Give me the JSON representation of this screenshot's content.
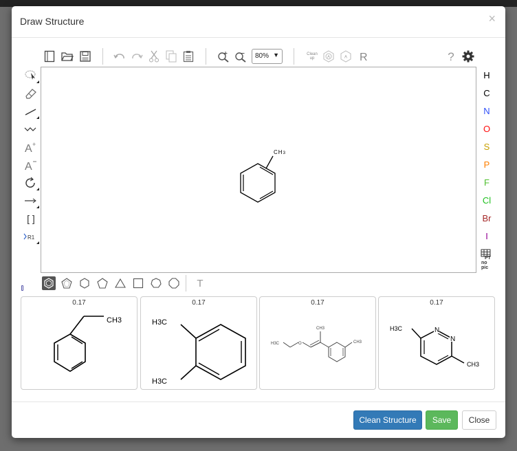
{
  "dialog": {
    "title": "Draw Structure",
    "close_glyph": "×"
  },
  "toolbar": {
    "zoom_value": "80%",
    "cleanup_label": "Clean up",
    "cleanup_line1": "Clean",
    "cleanup_line2": "up",
    "help_glyph": "?",
    "icons": [
      "new-document-icon",
      "open-file-icon",
      "save-icon",
      "undo-icon",
      "redo-icon",
      "cut-icon",
      "copy-icon",
      "paste-icon",
      "zoom-in-icon",
      "zoom-out-icon",
      "clean-up-icon",
      "aromatize-icon",
      "dearomatize-icon",
      "calculate-cip-icon",
      "help-icon",
      "settings-gear-icon"
    ]
  },
  "left_tools": {
    "icons": [
      "select-lasso-icon",
      "eraser-icon",
      "single-bond-icon",
      "chain-icon",
      "charge-plus-icon",
      "charge-minus-icon",
      "rotate-icon",
      "reaction-arrow-icon",
      "s-group-brackets-icon",
      "r-group-icon"
    ],
    "charge_plus_label": "A",
    "charge_minus_label": "A",
    "brackets_label": "[ ]",
    "rgroup_label": "R1"
  },
  "atoms": [
    {
      "symbol": "H",
      "color": "#000000"
    },
    {
      "symbol": "C",
      "color": "#000000"
    },
    {
      "symbol": "N",
      "color": "#3050F8"
    },
    {
      "symbol": "O",
      "color": "#FF0D0D"
    },
    {
      "symbol": "S",
      "color": "#C8A000"
    },
    {
      "symbol": "P",
      "color": "#FF8000"
    },
    {
      "symbol": "F",
      "color": "#50C030"
    },
    {
      "symbol": "Cl",
      "color": "#1FC01F"
    },
    {
      "symbol": "Br",
      "color": "#A62929"
    },
    {
      "symbol": "I",
      "color": "#940094"
    }
  ],
  "periodic_table": {
    "line1": "PT",
    "line2": "no",
    "line3": "pic"
  },
  "canvas": {
    "molecule_label": "CH3",
    "label_C": "C",
    "label_H": "H",
    "label_3": "3"
  },
  "bottom_tools": {
    "shapes": [
      "benzene-icon",
      "cyclopentadiene-icon",
      "cyclohexane-icon",
      "cyclopentane-icon",
      "cyclopropane-icon",
      "cyclobutane-icon",
      "cycloheptane-icon",
      "cyclooctane-icon"
    ],
    "text_tool": "T"
  },
  "templates": [
    {
      "score": "0.17",
      "labels": [
        "CH3"
      ]
    },
    {
      "score": "0.17",
      "labels": [
        "H3C",
        "H3C"
      ]
    },
    {
      "score": "0.17",
      "labels": [
        "H3C",
        "O",
        "CH3",
        "CH3"
      ]
    },
    {
      "score": "0.17",
      "labels": [
        "H3C",
        "N",
        "N",
        "CH3"
      ]
    }
  ],
  "footer": {
    "clean_label": "Clean Structure",
    "save_label": "Save",
    "close_label": "Close"
  },
  "colors": {
    "primary": "#337ab7",
    "success": "#5cb85c"
  }
}
